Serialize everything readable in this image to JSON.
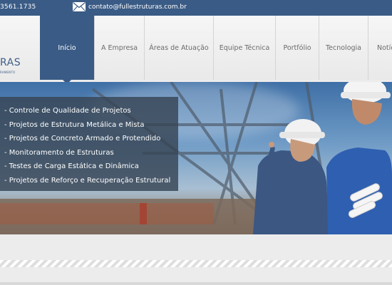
{
  "topbar": {
    "phone": "3561.1735",
    "email": "contato@fullestruturas.com.br"
  },
  "logo": {
    "text": "RAS",
    "tagline": "RAMENTO"
  },
  "nav": {
    "items": [
      {
        "label": "Início"
      },
      {
        "label": "A Empresa"
      },
      {
        "label": "Áreas de Atuação"
      },
      {
        "label": "Equipe Técnica"
      },
      {
        "label": "Portfólio"
      },
      {
        "label": "Tecnologia"
      },
      {
        "label": "Notíc"
      }
    ]
  },
  "hero": {
    "services": [
      "- Controle de Qualidade de Projetos",
      "- Projetos de Estrutura Metálica e Mista",
      "- Projetos de Concreto Armado e Protendido",
      "- Monitoramento de Estruturas",
      "- Testes de Carga Estática e Dinâmica",
      "- Projetos de Reforço e Recuperação Estrutural"
    ]
  },
  "colors": {
    "brand": "#3a5b85",
    "overlay": "#374454"
  },
  "icons": {
    "email": "envelope-icon"
  }
}
